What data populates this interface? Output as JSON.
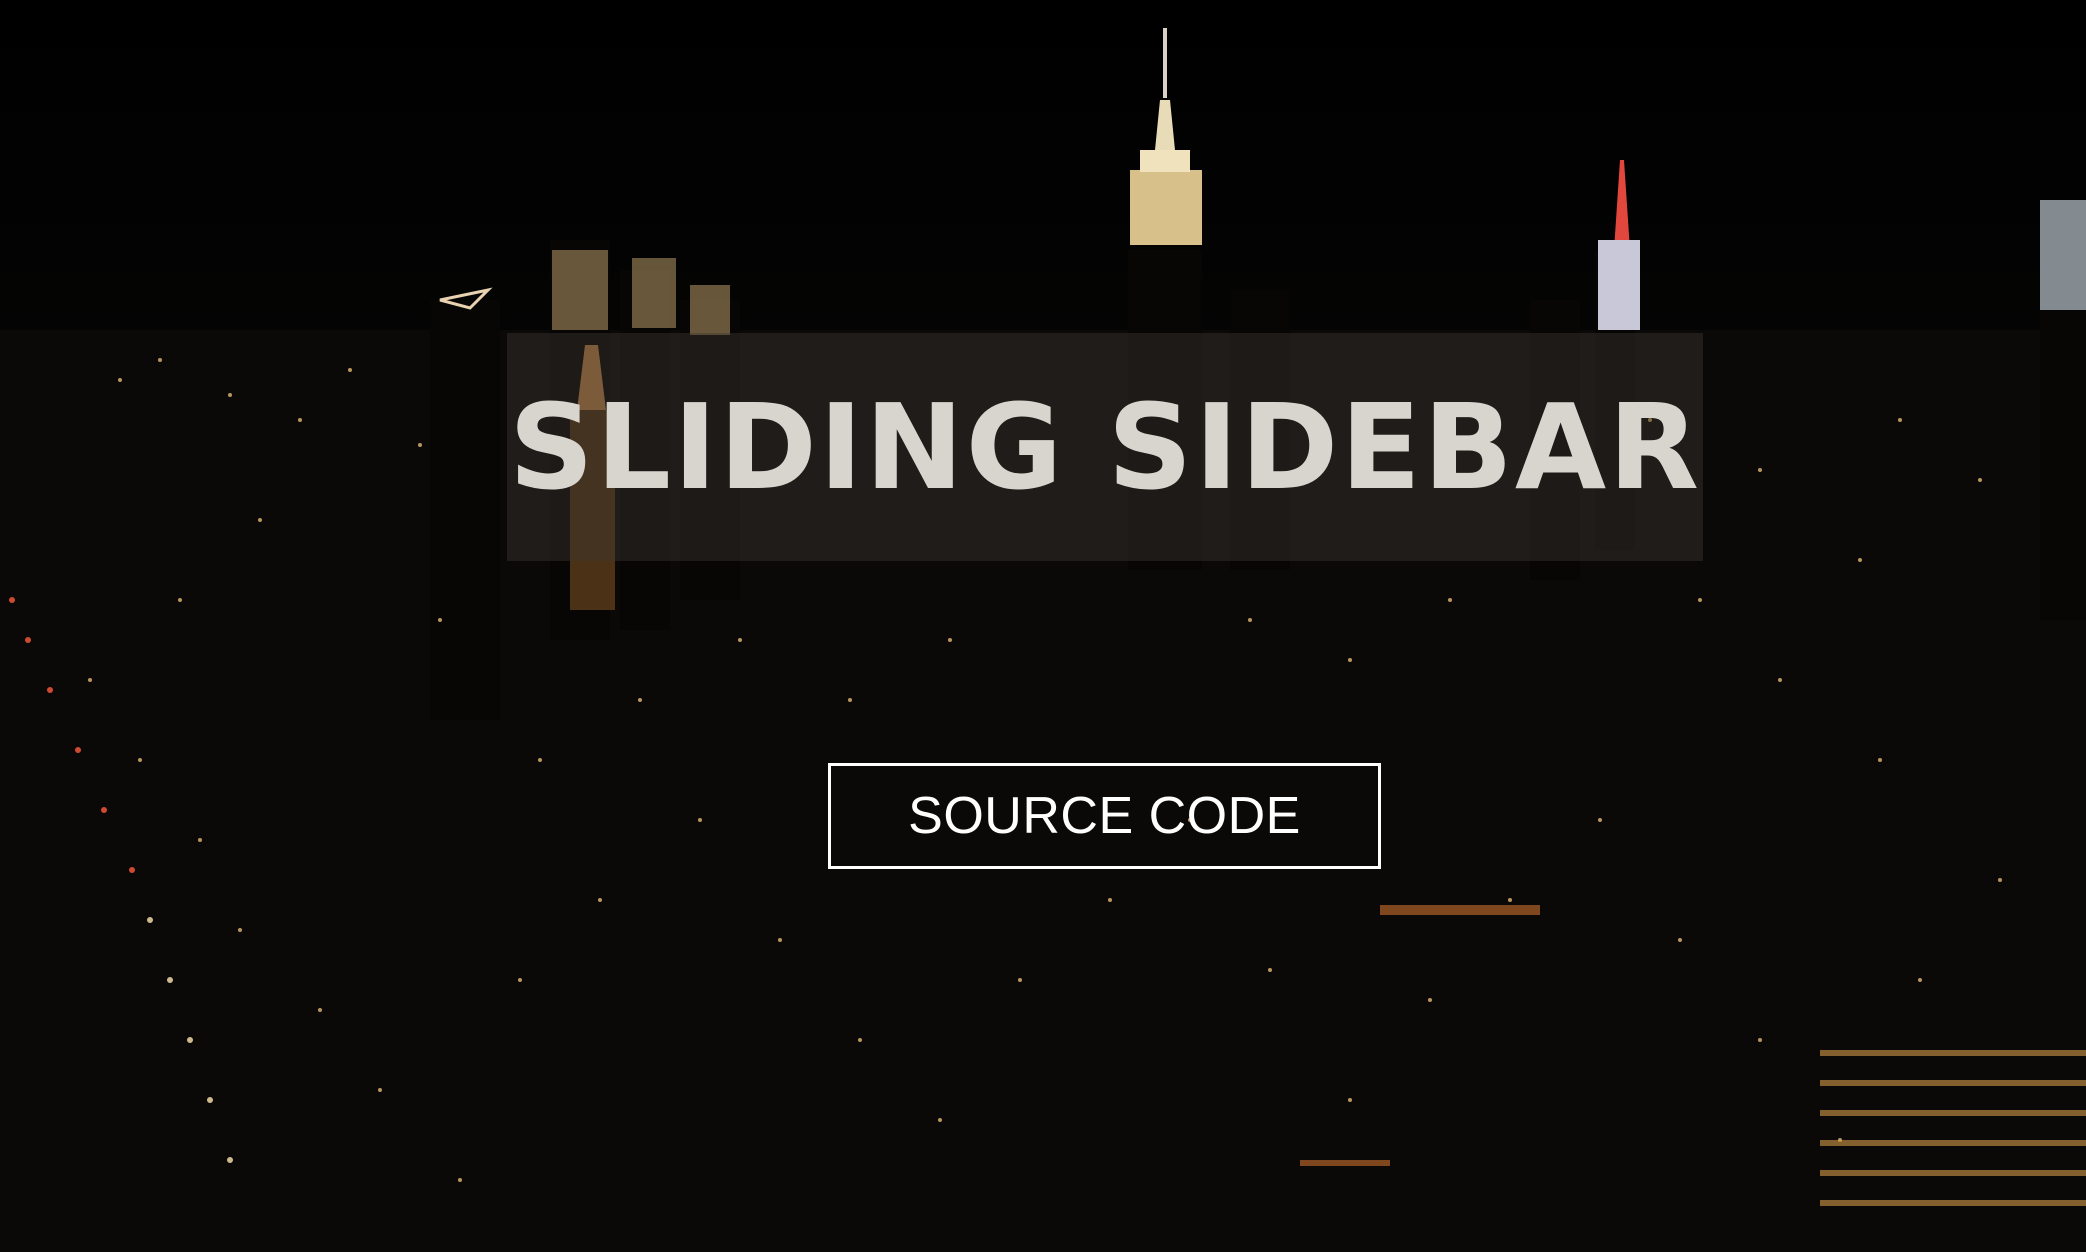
{
  "hero": {
    "title": "SLIDING SIDEBAR",
    "button_label": "SOURCE CODE"
  },
  "background": {
    "description_icon": "city-night-skyline",
    "colors": {
      "sky": "#000000",
      "window_warm": "#f3c57a",
      "window_white": "#ffffff",
      "accent_red": "#ff3b30",
      "title_box": "rgba(60,55,50,0.42)",
      "title_text": "#d8d5ce",
      "button_border": "#ffffff"
    }
  }
}
